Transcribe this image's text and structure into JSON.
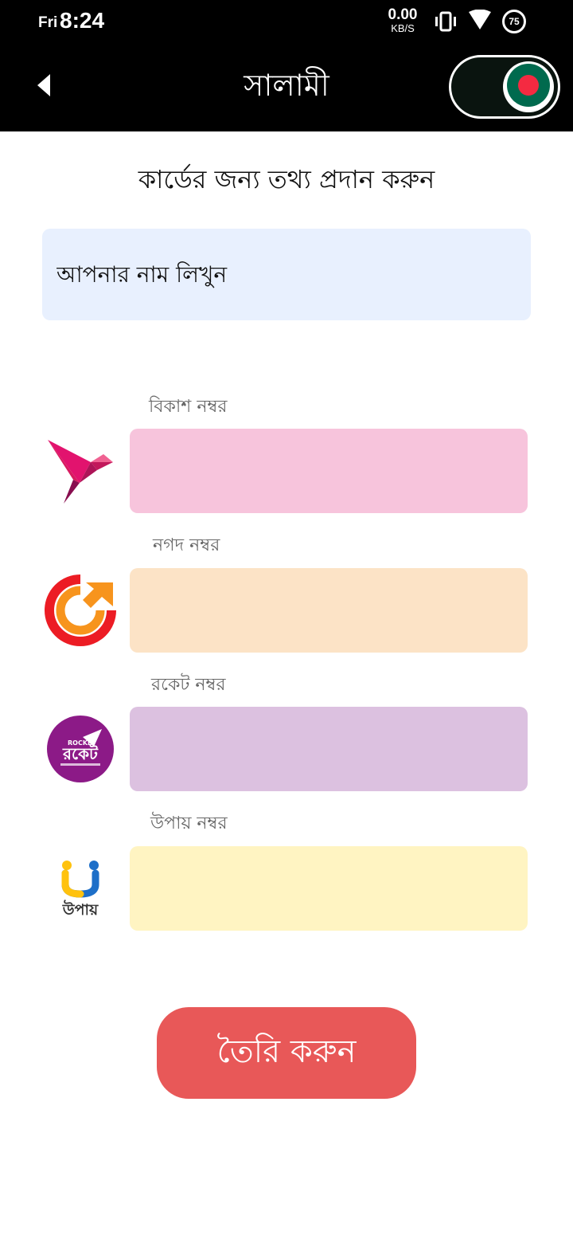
{
  "status_bar": {
    "day": "Fri",
    "time": "8:24",
    "net_speed_value": "0.00",
    "net_speed_unit": "KB/S",
    "battery": "75",
    "icons": [
      "vibrate-icon",
      "wifi-icon",
      "battery-icon"
    ]
  },
  "app_bar": {
    "title": "সালামী",
    "back_icon": "back-arrow-icon",
    "toggle_state": "on",
    "toggle_knob_icon": "bangladesh-flag-icon"
  },
  "form": {
    "heading": "কার্ডের জন্য তথ্য প্রদান করুন",
    "name_placeholder": "আপনার নাম লিখুন",
    "payments": [
      {
        "label": "বিকাশ নম্বর",
        "logo": "bkash-logo-icon",
        "value": "",
        "color": "#f7c4dc"
      },
      {
        "label": "নগদ নম্বর",
        "logo": "nagad-logo-icon",
        "value": "",
        "color": "#fce3c6"
      },
      {
        "label": "রকেট নম্বর",
        "logo": "rocket-logo-icon",
        "value": "",
        "color": "#dcc1e0"
      },
      {
        "label": "উপায় নম্বর",
        "logo": "upay-logo-icon",
        "value": "",
        "color": "#fff4c2"
      }
    ],
    "rocket_logo_text": "রকেট",
    "rocket_logo_caption": "ROCKET",
    "upay_logo_text": "উপায়",
    "submit_label": "তৈরি করুন"
  },
  "colors": {
    "bar_background": "#000000",
    "submit_button": "#e85858",
    "name_field": "#e8f0fe",
    "flag_green": "#006a4e",
    "flag_red": "#f42a41"
  }
}
